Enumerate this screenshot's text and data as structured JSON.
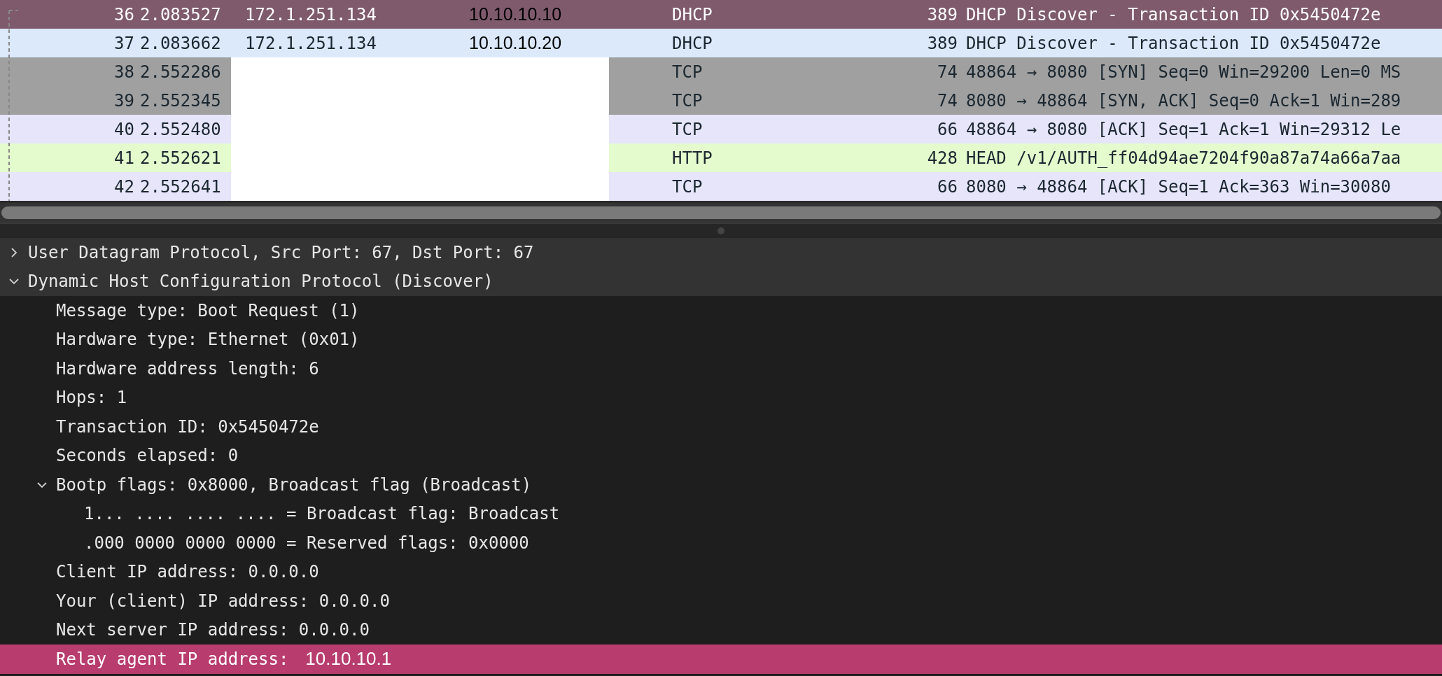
{
  "packets": {
    "rows": [
      {
        "no": "36",
        "time": "2.083527",
        "source": "172.1.251.134",
        "destination": "10.10.10.10",
        "protocol": "DHCP",
        "length": "389",
        "info": "DHCP Discover - Transaction ID 0x5450472e",
        "selected": true
      },
      {
        "no": "37",
        "time": "2.083662",
        "source": "172.1.251.134",
        "destination": "10.10.10.20",
        "protocol": "DHCP",
        "length": "389",
        "info": "DHCP Discover - Transaction ID 0x5450472e",
        "color": "#dbe9fb",
        "selected": false
      },
      {
        "no": "38",
        "time": "2.552286",
        "protocol": "TCP",
        "length": "74",
        "info": "48864 → 8080 [SYN] Seq=0 Win=29200 Len=0 MS",
        "color": "#a0a0a0",
        "selected": false
      },
      {
        "no": "39",
        "time": "2.552345",
        "protocol": "TCP",
        "length": "74",
        "info": "8080 → 48864 [SYN, ACK] Seq=0 Ack=1 Win=289",
        "color": "#a0a0a0",
        "selected": false
      },
      {
        "no": "40",
        "time": "2.552480",
        "protocol": "TCP",
        "length": "66",
        "info": "48864 → 8080 [ACK] Seq=1 Ack=1 Win=29312 Le",
        "color": "#e6e5fa",
        "selected": false
      },
      {
        "no": "41",
        "time": "2.552621",
        "protocol": "HTTP",
        "length": "428",
        "info": "HEAD /v1/AUTH_ff04d94ae7204f90a87a74a66a7aa",
        "color": "#e3fbcd",
        "selected": false
      },
      {
        "no": "42",
        "time": "2.552641",
        "protocol": "TCP",
        "length": "66",
        "info": "8080 → 48864 [ACK] Seq=1 Ack=363 Win=30080",
        "color": "#e6e5fa",
        "selected": false
      }
    ]
  },
  "details": [
    {
      "text": "User Datagram Protocol, Src Port: 67, Dst Port: 67",
      "expanded": false,
      "selected": false
    },
    {
      "text": "Dynamic Host Configuration Protocol (Discover)",
      "expanded": true,
      "selected": false,
      "children": [
        {
          "text": "Message type: Boot Request (1)",
          "selected": false
        },
        {
          "text": "Hardware type: Ethernet (0x01)",
          "selected": false
        },
        {
          "text": "Hardware address length: 6",
          "selected": false
        },
        {
          "text": "Hops: 1",
          "selected": false
        },
        {
          "text": "Transaction ID: 0x5450472e",
          "selected": false
        },
        {
          "text": "Seconds elapsed: 0",
          "selected": false
        },
        {
          "text": "Bootp flags: 0x8000, Broadcast flag (Broadcast)",
          "expanded": true,
          "selected": false,
          "children": [
            {
              "text": "1... .... .... .... = Broadcast flag: Broadcast",
              "selected": false
            },
            {
              "text": ".000 0000 0000 0000 = Reserved flags: 0x0000",
              "selected": false
            }
          ]
        },
        {
          "text": "Client IP address: 0.0.0.0",
          "selected": false
        },
        {
          "text": "Your (client) IP address: 0.0.0.0",
          "selected": false
        },
        {
          "text": "Next server IP address: 0.0.0.0",
          "selected": false
        },
        {
          "text": "Relay agent IP address:",
          "value": "10.10.10.1",
          "selected": true
        }
      ]
    }
  ]
}
